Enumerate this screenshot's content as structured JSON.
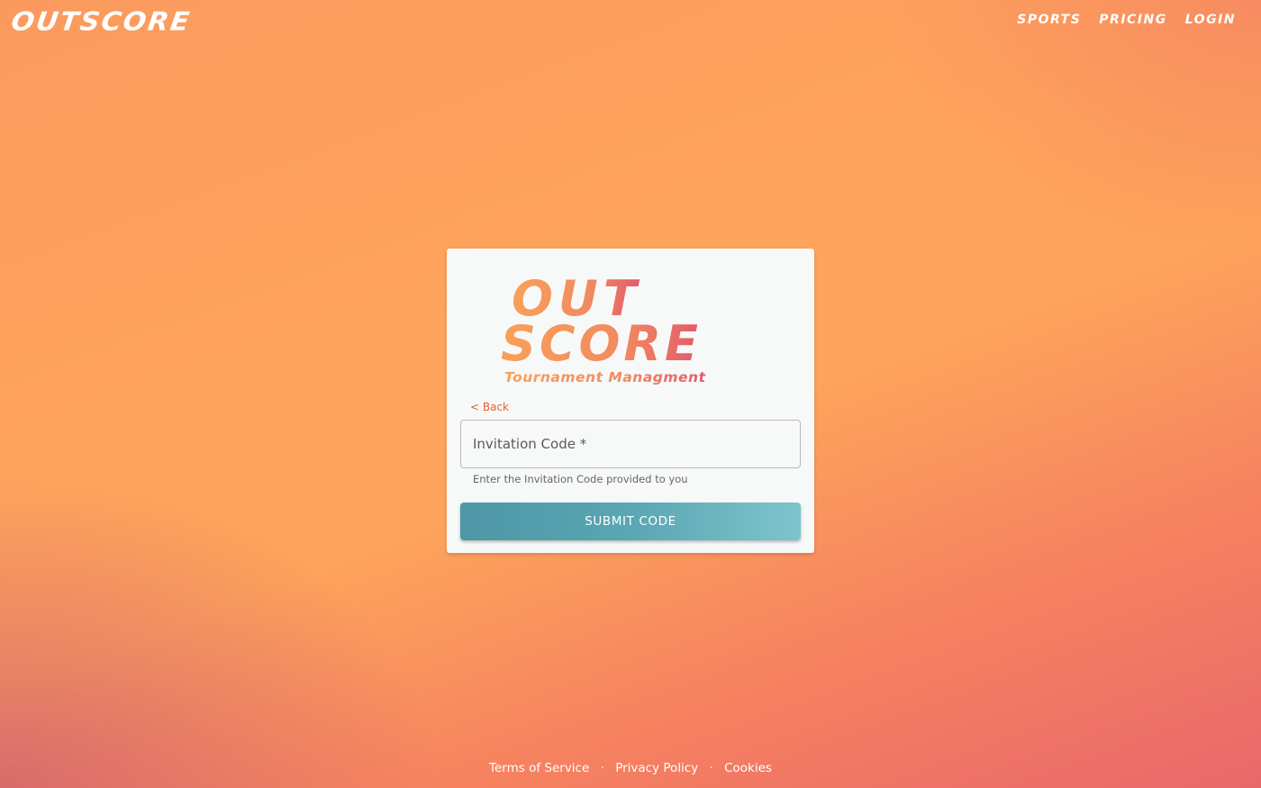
{
  "header": {
    "brand": "OUTSCORE",
    "nav": [
      {
        "label": "SPORTS"
      },
      {
        "label": "PRICING"
      },
      {
        "label": "LOGIN"
      }
    ]
  },
  "card": {
    "logo": {
      "line1": "OUT",
      "line2": "SCORE",
      "tagline": "Tournament Managment"
    },
    "back_label": "< Back",
    "input": {
      "label": "Invitation Code *",
      "value": ""
    },
    "helper": "Enter the Invitation Code provided to you",
    "submit_label": "SUBMIT CODE"
  },
  "footer": {
    "links": [
      "Terms of Service",
      "Privacy Policy",
      "Cookies"
    ],
    "separator": "·"
  },
  "colors": {
    "accent": "#e8622f",
    "button": "#5aa6b3",
    "logo_gradient_start": "#f9a158",
    "logo_gradient_end": "#e4596b"
  }
}
